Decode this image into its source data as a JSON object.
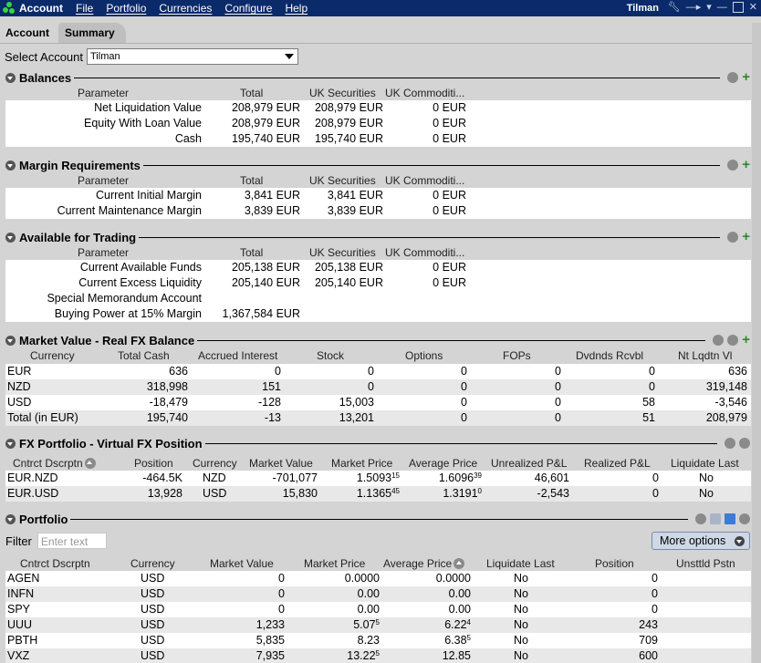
{
  "titlebar": {
    "app": "Account",
    "menus": [
      "File",
      "Portfolio",
      "Currencies",
      "Configure",
      "Help"
    ],
    "user": "Tilman"
  },
  "tabs": [
    "Account",
    "Summary"
  ],
  "select_account": {
    "label": "Select Account",
    "value": "Tilman"
  },
  "balances": {
    "title": "Balances",
    "headers": [
      "Parameter",
      "Total",
      "UK Securities",
      "UK Commoditi..."
    ],
    "rows": [
      [
        "Net Liquidation Value",
        "208,979 EUR",
        "208,979 EUR",
        "0 EUR"
      ],
      [
        "Equity With Loan Value",
        "208,979 EUR",
        "208,979 EUR",
        "0 EUR"
      ],
      [
        "Cash",
        "195,740 EUR",
        "195,740 EUR",
        "0 EUR"
      ]
    ]
  },
  "margin": {
    "title": "Margin Requirements",
    "headers": [
      "Parameter",
      "Total",
      "UK Securities",
      "UK Commoditi..."
    ],
    "rows": [
      [
        "Current Initial Margin",
        "3,841 EUR",
        "3,841 EUR",
        "0 EUR"
      ],
      [
        "Current Maintenance Margin",
        "3,839 EUR",
        "3,839 EUR",
        "0 EUR"
      ]
    ]
  },
  "available": {
    "title": "Available for Trading",
    "headers": [
      "Parameter",
      "Total",
      "UK Securities",
      "UK Commoditi..."
    ],
    "rows": [
      [
        "Current Available Funds",
        "205,138 EUR",
        "205,138 EUR",
        "0 EUR"
      ],
      [
        "Current Excess Liquidity",
        "205,140 EUR",
        "205,140 EUR",
        "0 EUR"
      ],
      [
        "Special Memorandum Account",
        "",
        "",
        ""
      ],
      [
        "Buying Power at 15% Margin",
        "1,367,584 EUR",
        "",
        ""
      ]
    ]
  },
  "market_value": {
    "title": "Market Value - Real FX Balance",
    "headers": [
      "Currency",
      "Total Cash",
      "Accrued Interest",
      "Stock",
      "Options",
      "FOPs",
      "Dvdnds Rcvbl",
      "Nt Lqdtn Vl"
    ],
    "rows": [
      [
        "EUR",
        "636",
        "0",
        "0",
        "0",
        "0",
        "0",
        "636"
      ],
      [
        "NZD",
        "318,998",
        "151",
        "0",
        "0",
        "0",
        "0",
        "319,148"
      ],
      [
        "USD",
        "-18,479",
        "-128",
        "15,003",
        "0",
        "0",
        "58",
        "-3,546"
      ],
      [
        "Total (in EUR)",
        "195,740",
        "-13",
        "13,201",
        "0",
        "0",
        "51",
        "208,979"
      ]
    ]
  },
  "fx_portfolio": {
    "title": "FX Portfolio - Virtual FX Position",
    "headers": [
      "Cntrct Dscrptn",
      "Position",
      "Currency",
      "Market Value",
      "Market Price",
      "Average Price",
      "Unrealized P&L",
      "Realized P&L",
      "Liquidate Last"
    ],
    "rows": [
      {
        "desc": "EUR.NZD",
        "position": "-464.5K",
        "currency": "NZD",
        "market_value": "-701,077",
        "mp_main": "1.5093",
        "mp_sup": "15",
        "ap_main": "1.6096",
        "ap_sup": "39",
        "unrealized": "46,601",
        "realized": "0",
        "liquidate": "No"
      },
      {
        "desc": "EUR.USD",
        "position": "13,928",
        "currency": "USD",
        "market_value": "15,830",
        "mp_main": "1.1365",
        "mp_sup": "45",
        "ap_main": "1.3191",
        "ap_sup": "0",
        "unrealized": "-2,543",
        "realized": "0",
        "liquidate": "No"
      }
    ]
  },
  "portfolio": {
    "title": "Portfolio",
    "filter_label": "Filter",
    "filter_placeholder": "Enter text",
    "more_options": "More options",
    "headers": [
      "Cntrct Dscrptn",
      "Currency",
      "Market Value",
      "Market Price",
      "Average Price",
      "Liquidate Last",
      "Position",
      "Unsttld Pstn"
    ],
    "rows": [
      {
        "desc": "AGEN",
        "currency": "USD",
        "market_value": "0",
        "mp_main": "0.0000",
        "mp_sup": "",
        "ap_main": "0.0000",
        "ap_sup": "",
        "liquidate": "No",
        "position": "0"
      },
      {
        "desc": "INFN",
        "currency": "USD",
        "market_value": "0",
        "mp_main": "0.00",
        "mp_sup": "",
        "ap_main": "0.00",
        "ap_sup": "",
        "liquidate": "No",
        "position": "0"
      },
      {
        "desc": "SPY",
        "currency": "USD",
        "market_value": "0",
        "mp_main": "0.00",
        "mp_sup": "",
        "ap_main": "0.00",
        "ap_sup": "",
        "liquidate": "No",
        "position": "0"
      },
      {
        "desc": "UUU",
        "currency": "USD",
        "market_value": "1,233",
        "mp_main": "5.07",
        "mp_sup": "5",
        "ap_main": "6.22",
        "ap_sup": "4",
        "liquidate": "No",
        "position": "243"
      },
      {
        "desc": "PBTH",
        "currency": "USD",
        "market_value": "5,835",
        "mp_main": "8.23",
        "mp_sup": "",
        "ap_main": "6.38",
        "ap_sup": "5",
        "liquidate": "No",
        "position": "709"
      },
      {
        "desc": "VXZ",
        "currency": "USD",
        "market_value": "7,935",
        "mp_main": "13.22",
        "mp_sup": "5",
        "ap_main": "12.85",
        "ap_sup": "",
        "liquidate": "No",
        "position": "600"
      }
    ]
  }
}
